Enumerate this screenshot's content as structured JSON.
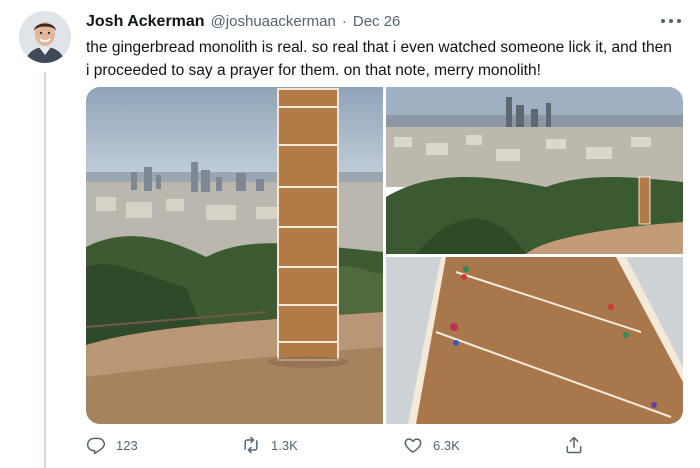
{
  "tweet": {
    "display_name": "Josh Ackerman",
    "handle": "@joshuaackerman",
    "separator": "·",
    "date": "Dec 26",
    "text": "the gingerbread monolith is real. so real that i even watched someone lick it, and then i proceeded to say a prayer for them. on that note, merry monolith!"
  },
  "icons": {
    "avatar": "avatar-photo",
    "more": "more-options-icon",
    "reply": "reply-icon",
    "retweet": "retweet-icon",
    "like": "heart-icon",
    "share": "share-icon"
  },
  "media": [
    {
      "description_label": ""
    },
    {
      "description_label": ""
    },
    {
      "description_label": ""
    }
  ],
  "actions": {
    "reply_count": "123",
    "retweet_count": "1.3K",
    "like_count": "6.3K"
  },
  "colors": {
    "text_primary": "#0f1419",
    "text_secondary": "#536471",
    "divider": "#cfd9de"
  }
}
